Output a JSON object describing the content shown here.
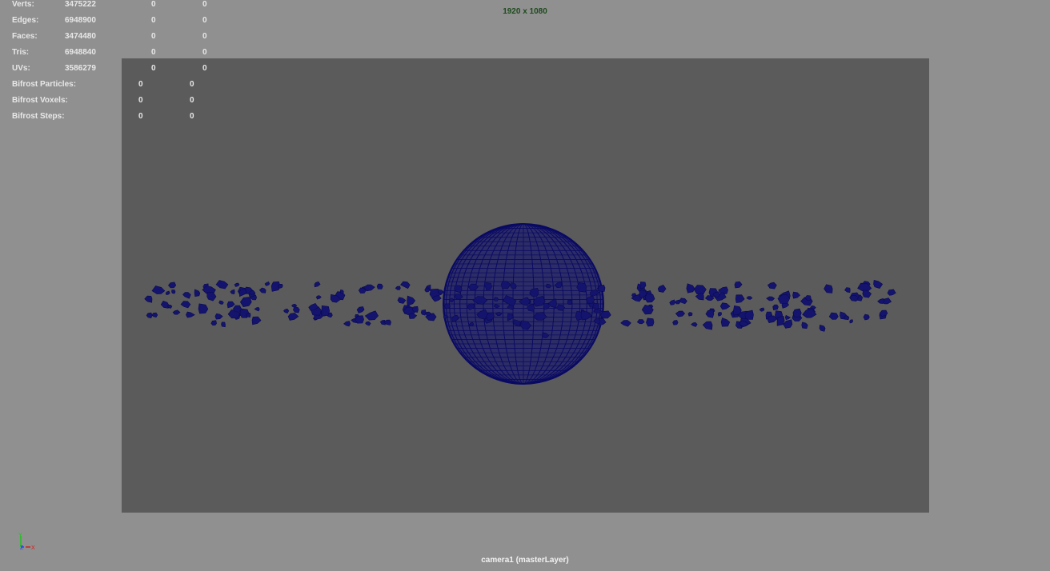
{
  "viewport": {
    "resolution_gate": "1920 x 1080",
    "camera_label": "camera1 (masterLayer)"
  },
  "hud": {
    "rows": [
      {
        "label": "Verts:",
        "total": "3475222",
        "selected": "0",
        "visible": "0"
      },
      {
        "label": "Edges:",
        "total": "6948900",
        "selected": "0",
        "visible": "0"
      },
      {
        "label": "Faces:",
        "total": "3474480",
        "selected": "0",
        "visible": "0"
      },
      {
        "label": "Tris:",
        "total": "6948840",
        "selected": "0",
        "visible": "0"
      },
      {
        "label": "UVs:",
        "total": "3586279",
        "selected": "0",
        "visible": "0"
      }
    ],
    "bifrost_rows": [
      {
        "label": "Bifrost Particles:",
        "selected": "0",
        "visible": "0"
      },
      {
        "label": "Bifrost Voxels:",
        "selected": "0",
        "visible": "0"
      },
      {
        "label": "Bifrost Steps:",
        "selected": "0",
        "visible": "0"
      }
    ]
  },
  "axis_gizmo": {
    "y_label": "Y",
    "z_label": "Z",
    "x_label": "X"
  },
  "colors": {
    "background": "#909090",
    "resolution_gate": "#5b5b5b",
    "mesh_wireframe": "#0a0a64",
    "axis_x": "#d02020",
    "axis_y": "#20c020",
    "axis_z": "#2040ff"
  },
  "scene_objects": [
    "sphere-mesh",
    "debris-particles"
  ]
}
